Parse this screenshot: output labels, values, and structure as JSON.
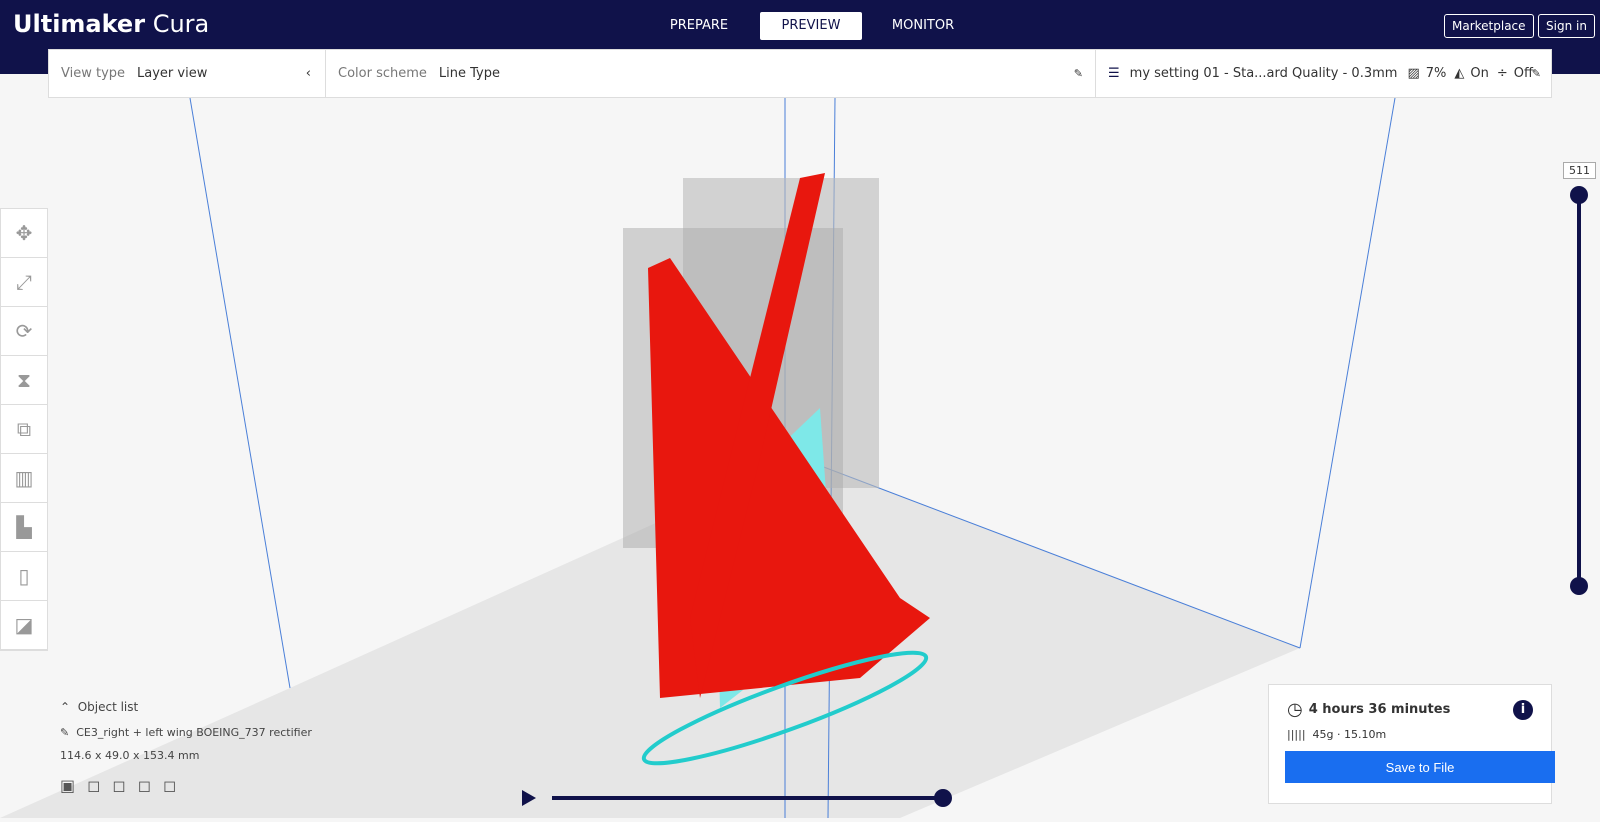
{
  "app": {
    "brand_bold": "Ultimaker",
    "brand_light": "Cura"
  },
  "stages": [
    "PREPARE",
    "PREVIEW",
    "MONITOR"
  ],
  "top_buttons": {
    "marketplace": "Marketplace",
    "signin": "Sign in"
  },
  "header": {
    "view_type_label": "View type",
    "view_type_value": "Layer view",
    "color_scheme_label": "Color scheme",
    "color_scheme_value": "Line Type",
    "profile": "my setting 01 - Sta...ard Quality - 0.3mm",
    "infill": "7%",
    "support": "On",
    "adhesion": "Off"
  },
  "layer": {
    "current": "511"
  },
  "object_list": {
    "title": "Object list",
    "name": "CE3_right + left  wing BOEING_737 rectifier",
    "dimensions": "114.6 x 49.0 x 153.4 mm"
  },
  "print": {
    "time": "4 hours 36 minutes",
    "material": "45g · 15.10m",
    "save": "Save to File"
  },
  "colors": {
    "brand": "#10124a",
    "accent": "#196ef0"
  }
}
